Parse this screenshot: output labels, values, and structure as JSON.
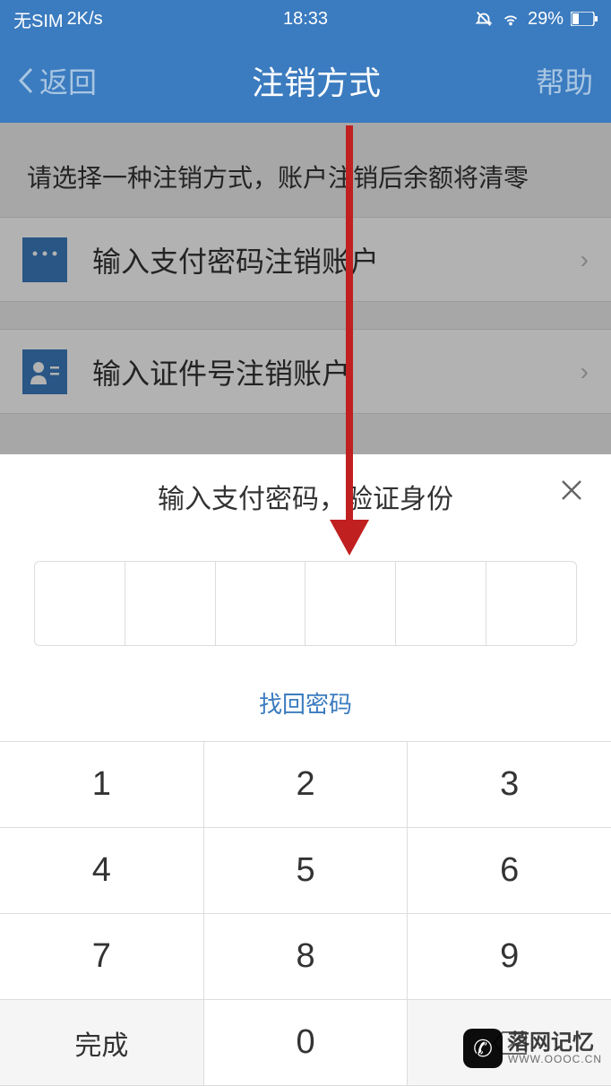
{
  "status": {
    "sim": "无SIM",
    "speed": "2K/s",
    "time": "18:33",
    "battery": "29%"
  },
  "nav": {
    "back": "返回",
    "title": "注销方式",
    "help": "帮助"
  },
  "content": {
    "instruction": "请选择一种注销方式，账户注销后余额将清零",
    "item1": "输入支付密码注销账户",
    "item2": "输入证件号注销账户"
  },
  "modal": {
    "title": "输入支付密码，验证身份",
    "recover": "找回密码"
  },
  "keypad": {
    "k1": "1",
    "k2": "2",
    "k3": "3",
    "k4": "4",
    "k5": "5",
    "k6": "6",
    "k7": "7",
    "k8": "8",
    "k9": "9",
    "k0": "0",
    "done": "完成"
  },
  "watermark": {
    "title": "落网记忆",
    "url": "WWW.OOOC.CN"
  }
}
